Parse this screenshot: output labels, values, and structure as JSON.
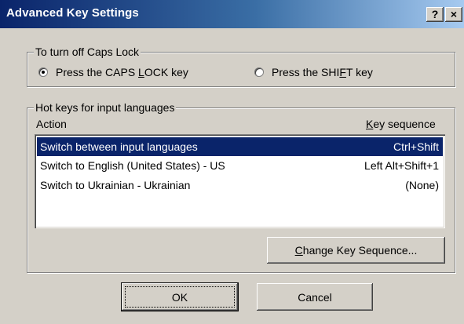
{
  "window": {
    "title": "Advanced Key Settings",
    "help_label": "?",
    "close_label": "×"
  },
  "caps_lock": {
    "group_label": "To turn off Caps Lock",
    "options": [
      {
        "pre": "Press the CAPS ",
        "key": "L",
        "post": "OCK key",
        "selected": true
      },
      {
        "pre": "Press the SHI",
        "key": "F",
        "post": "T key",
        "selected": false
      }
    ]
  },
  "hotkeys": {
    "group_label": "Hot keys for input languages",
    "col_action": "Action",
    "col_key_underline": "K",
    "col_key_rest": "ey sequence",
    "rows": [
      {
        "action": "Switch between input languages",
        "sequence": "Ctrl+Shift",
        "selected": true
      },
      {
        "action": "Switch to English (United States) - US",
        "sequence": "Left Alt+Shift+1",
        "selected": false
      },
      {
        "action": "Switch to Ukrainian - Ukrainian",
        "sequence": "(None)",
        "selected": false
      }
    ],
    "change_underline": "C",
    "change_rest": "hange Key Sequence..."
  },
  "buttons": {
    "ok": "OK",
    "cancel": "Cancel"
  },
  "colors": {
    "face": "#d4d0c8",
    "title_start": "#0a246a",
    "selection": "#0a246a"
  }
}
